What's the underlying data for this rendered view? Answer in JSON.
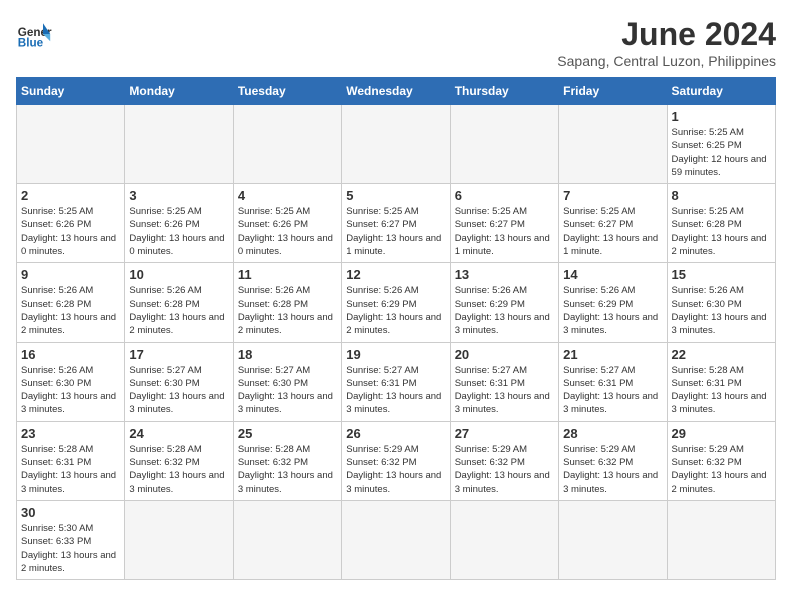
{
  "logo": {
    "text_general": "General",
    "text_blue": "Blue"
  },
  "title": {
    "month_year": "June 2024",
    "location": "Sapang, Central Luzon, Philippines"
  },
  "weekdays": [
    "Sunday",
    "Monday",
    "Tuesday",
    "Wednesday",
    "Thursday",
    "Friday",
    "Saturday"
  ],
  "weeks": [
    [
      {
        "day": "",
        "info": ""
      },
      {
        "day": "",
        "info": ""
      },
      {
        "day": "",
        "info": ""
      },
      {
        "day": "",
        "info": ""
      },
      {
        "day": "",
        "info": ""
      },
      {
        "day": "",
        "info": ""
      },
      {
        "day": "1",
        "info": "Sunrise: 5:25 AM\nSunset: 6:25 PM\nDaylight: 12 hours\nand 59 minutes."
      }
    ],
    [
      {
        "day": "2",
        "info": "Sunrise: 5:25 AM\nSunset: 6:26 PM\nDaylight: 13 hours\nand 0 minutes."
      },
      {
        "day": "3",
        "info": "Sunrise: 5:25 AM\nSunset: 6:26 PM\nDaylight: 13 hours\nand 0 minutes."
      },
      {
        "day": "4",
        "info": "Sunrise: 5:25 AM\nSunset: 6:26 PM\nDaylight: 13 hours\nand 0 minutes."
      },
      {
        "day": "5",
        "info": "Sunrise: 5:25 AM\nSunset: 6:27 PM\nDaylight: 13 hours\nand 1 minute."
      },
      {
        "day": "6",
        "info": "Sunrise: 5:25 AM\nSunset: 6:27 PM\nDaylight: 13 hours\nand 1 minute."
      },
      {
        "day": "7",
        "info": "Sunrise: 5:25 AM\nSunset: 6:27 PM\nDaylight: 13 hours\nand 1 minute."
      },
      {
        "day": "8",
        "info": "Sunrise: 5:25 AM\nSunset: 6:28 PM\nDaylight: 13 hours\nand 2 minutes."
      }
    ],
    [
      {
        "day": "9",
        "info": "Sunrise: 5:26 AM\nSunset: 6:28 PM\nDaylight: 13 hours\nand 2 minutes."
      },
      {
        "day": "10",
        "info": "Sunrise: 5:26 AM\nSunset: 6:28 PM\nDaylight: 13 hours\nand 2 minutes."
      },
      {
        "day": "11",
        "info": "Sunrise: 5:26 AM\nSunset: 6:28 PM\nDaylight: 13 hours\nand 2 minutes."
      },
      {
        "day": "12",
        "info": "Sunrise: 5:26 AM\nSunset: 6:29 PM\nDaylight: 13 hours\nand 2 minutes."
      },
      {
        "day": "13",
        "info": "Sunrise: 5:26 AM\nSunset: 6:29 PM\nDaylight: 13 hours\nand 3 minutes."
      },
      {
        "day": "14",
        "info": "Sunrise: 5:26 AM\nSunset: 6:29 PM\nDaylight: 13 hours\nand 3 minutes."
      },
      {
        "day": "15",
        "info": "Sunrise: 5:26 AM\nSunset: 6:30 PM\nDaylight: 13 hours\nand 3 minutes."
      }
    ],
    [
      {
        "day": "16",
        "info": "Sunrise: 5:26 AM\nSunset: 6:30 PM\nDaylight: 13 hours\nand 3 minutes."
      },
      {
        "day": "17",
        "info": "Sunrise: 5:27 AM\nSunset: 6:30 PM\nDaylight: 13 hours\nand 3 minutes."
      },
      {
        "day": "18",
        "info": "Sunrise: 5:27 AM\nSunset: 6:30 PM\nDaylight: 13 hours\nand 3 minutes."
      },
      {
        "day": "19",
        "info": "Sunrise: 5:27 AM\nSunset: 6:31 PM\nDaylight: 13 hours\nand 3 minutes."
      },
      {
        "day": "20",
        "info": "Sunrise: 5:27 AM\nSunset: 6:31 PM\nDaylight: 13 hours\nand 3 minutes."
      },
      {
        "day": "21",
        "info": "Sunrise: 5:27 AM\nSunset: 6:31 PM\nDaylight: 13 hours\nand 3 minutes."
      },
      {
        "day": "22",
        "info": "Sunrise: 5:28 AM\nSunset: 6:31 PM\nDaylight: 13 hours\nand 3 minutes."
      }
    ],
    [
      {
        "day": "23",
        "info": "Sunrise: 5:28 AM\nSunset: 6:31 PM\nDaylight: 13 hours\nand 3 minutes."
      },
      {
        "day": "24",
        "info": "Sunrise: 5:28 AM\nSunset: 6:32 PM\nDaylight: 13 hours\nand 3 minutes."
      },
      {
        "day": "25",
        "info": "Sunrise: 5:28 AM\nSunset: 6:32 PM\nDaylight: 13 hours\nand 3 minutes."
      },
      {
        "day": "26",
        "info": "Sunrise: 5:29 AM\nSunset: 6:32 PM\nDaylight: 13 hours\nand 3 minutes."
      },
      {
        "day": "27",
        "info": "Sunrise: 5:29 AM\nSunset: 6:32 PM\nDaylight: 13 hours\nand 3 minutes."
      },
      {
        "day": "28",
        "info": "Sunrise: 5:29 AM\nSunset: 6:32 PM\nDaylight: 13 hours\nand 3 minutes."
      },
      {
        "day": "29",
        "info": "Sunrise: 5:29 AM\nSunset: 6:32 PM\nDaylight: 13 hours\nand 2 minutes."
      }
    ],
    [
      {
        "day": "30",
        "info": "Sunrise: 5:30 AM\nSunset: 6:33 PM\nDaylight: 13 hours\nand 2 minutes."
      },
      {
        "day": "",
        "info": ""
      },
      {
        "day": "",
        "info": ""
      },
      {
        "day": "",
        "info": ""
      },
      {
        "day": "",
        "info": ""
      },
      {
        "day": "",
        "info": ""
      },
      {
        "day": "",
        "info": ""
      }
    ]
  ]
}
